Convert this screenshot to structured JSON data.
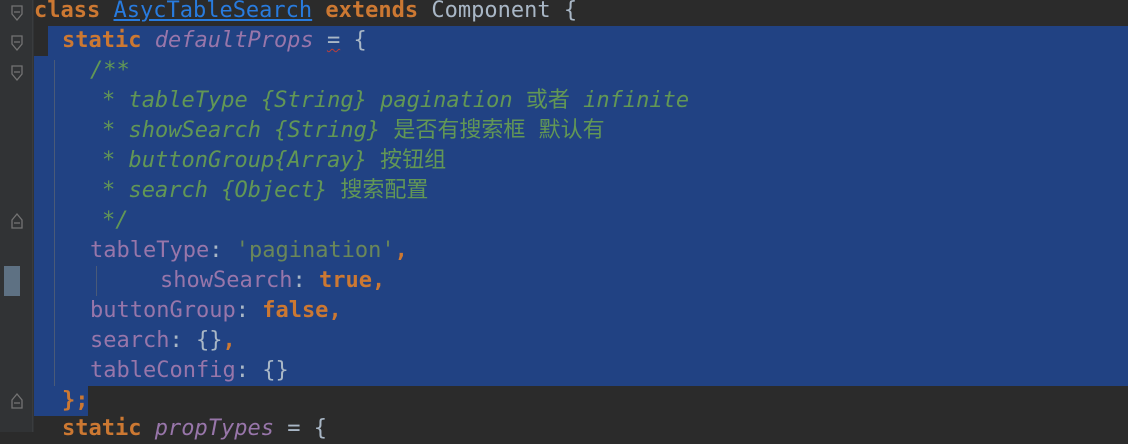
{
  "code": {
    "line1": {
      "kw1": "class",
      "class_name": "AsycTableSearch",
      "kw2": "extends",
      "parent": "Component {"
    },
    "line2": {
      "kw": "static",
      "prop": "defaultProps",
      "eq": "=",
      "brace": "{"
    },
    "comment_open": "/**",
    "comment_lines": [
      {
        "text": "* tableType {String} pagination ",
        "cn": "或者",
        "tail": " infinite"
      },
      {
        "text": "* showSearch {String} ",
        "cn": "是否有搜索框 默认有",
        "tail": ""
      },
      {
        "text": "* buttonGroup{Array} ",
        "cn": "按钮组",
        "tail": ""
      },
      {
        "text": "* search {Object} ",
        "cn": "搜索配置",
        "tail": ""
      }
    ],
    "comment_close": "*/",
    "props": [
      {
        "key": "tableType",
        "colon": ": ",
        "value": "'pagination'",
        "value_kind": "string",
        "trail": ","
      },
      {
        "key": "showSearch",
        "colon": ": ",
        "value": "true",
        "value_kind": "keyword",
        "trail": ","
      },
      {
        "key": "buttonGroup",
        "colon": ": ",
        "value": "false",
        "value_kind": "keyword",
        "trail": ","
      },
      {
        "key": "search",
        "colon": ": ",
        "value": "{}",
        "value_kind": "plain",
        "trail": ","
      },
      {
        "key": "tableConfig",
        "colon": ": ",
        "value": "{}",
        "value_kind": "plain",
        "trail": ""
      }
    ],
    "close": "};",
    "next_line": {
      "kw": "static",
      "prop": "propTypes",
      "rest": " = {"
    }
  },
  "colors": {
    "background": "#2b2b2b",
    "selection": "#214283",
    "keyword": "#cc7832",
    "comment": "#629755",
    "string": "#6a8759",
    "field": "#9876aa",
    "link": "#287bde"
  }
}
